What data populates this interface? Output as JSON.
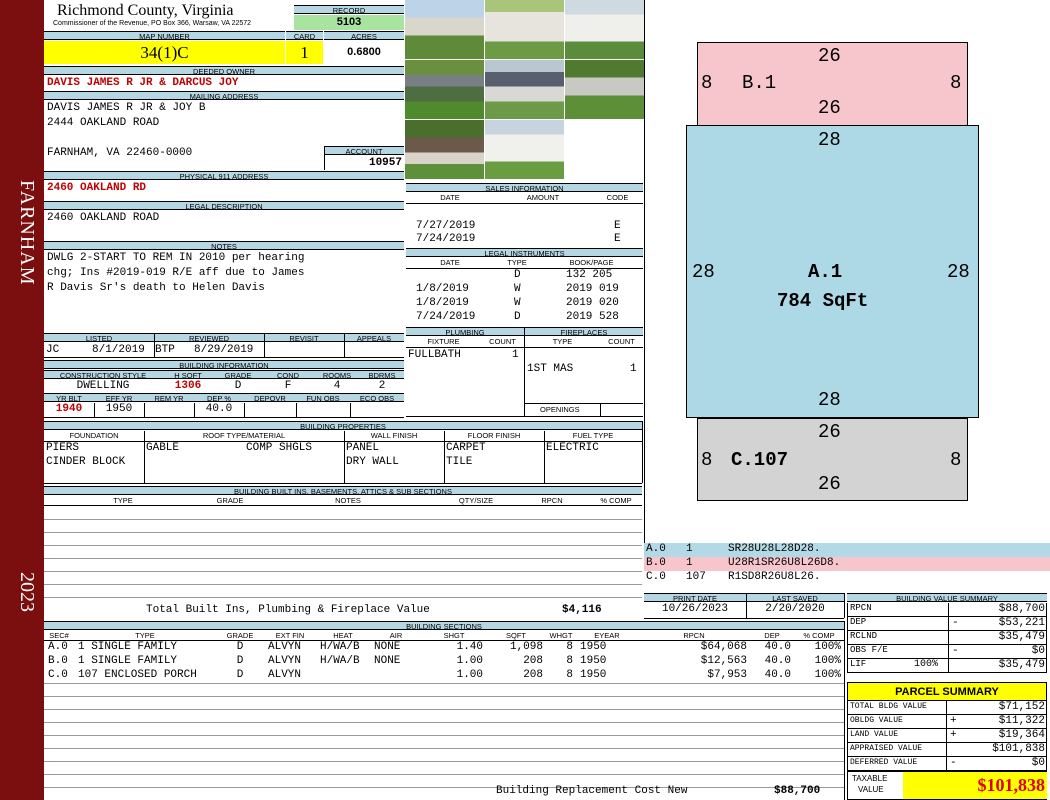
{
  "sidebar": {
    "city": "FARNHAM",
    "year": "2023"
  },
  "header": {
    "county": "Richmond County, Virginia",
    "commissioner": "Commissioner of the Revenue, PO Box 366, Warsaw, VA 22572",
    "record_label": "RECORD",
    "record": "5103",
    "map_label": "MAP NUMBER",
    "map": "34(1)C",
    "card_label": "CARD",
    "card": "1",
    "acres_label": "ACRES",
    "acres": "0.6800"
  },
  "owner": {
    "deeded_label": "DEEDED OWNER",
    "deeded": "DAVIS JAMES R JR & DARCUS JOY",
    "mailing_label": "MAILING ADDRESS",
    "mail1": "DAVIS JAMES R JR & JOY B",
    "mail2": "2444 OAKLAND ROAD",
    "mail3": "FARNHAM, VA 22460-0000",
    "account_label": "ACCOUNT",
    "account": "10957",
    "p911_label": "PHYSICAL 911 ADDRESS",
    "p911": "2460 OAKLAND RD",
    "legal_label": "LEGAL DESCRIPTION",
    "legal": "2460 OAKLAND ROAD"
  },
  "notes": {
    "label": "NOTES",
    "line1": "DWLG 2-START TO REM IN 2010 per hearing",
    "line2": "chg; Ins #2019-019 R/E aff due to James",
    "line3": "R Davis Sr's death to Helen Davis"
  },
  "review": {
    "listed_label": "LISTED",
    "reviewed_label": "REVIEWED",
    "revisit_label": "REVISIT",
    "appeals_label": "APPEALS",
    "lister": "JC",
    "listed": "8/1/2019",
    "reviewer": "BTP",
    "reviewed": "8/29/2019"
  },
  "building_info": {
    "label": "BUILDING INFORMATION",
    "h_const": "CONSTRUCTION STYLE",
    "h_hsqft": "H SQFT",
    "h_grade": "GRADE",
    "h_cond": "COND",
    "h_rooms": "ROOMS",
    "h_bdrms": "BDRMS",
    "const": "DWELLING",
    "hsqft": "1306",
    "grade": "D",
    "cond": "F",
    "rooms": "4",
    "bdrms": "2",
    "h_yrblt": "YR BLT",
    "h_effyr": "EFF YR",
    "h_remyr": "REM YR",
    "h_dep": "DEP %",
    "h_depovr": "DEPOVR",
    "h_funobs": "FUN OBS",
    "h_ecoobs": "ECO OBS",
    "yrblt": "1940",
    "effyr": "1950",
    "dep": "40.0"
  },
  "sales": {
    "label": "SALES INFORMATION",
    "h_date": "DATE",
    "h_amount": "AMOUNT",
    "h_code": "CODE",
    "rows": [
      {
        "date": "7/27/2019",
        "code": "E"
      },
      {
        "date": "7/24/2019",
        "code": "E"
      }
    ]
  },
  "legal_instruments": {
    "label": "LEGAL INSTRUMENTS",
    "h_date": "DATE",
    "h_type": "TYPE",
    "h_book": "BOOK/PAGE",
    "rows": [
      {
        "date": "",
        "type": "D",
        "book": "132 205"
      },
      {
        "date": "1/8/2019",
        "type": "W",
        "book": "2019 019"
      },
      {
        "date": "1/8/2019",
        "type": "W",
        "book": "2019 020"
      },
      {
        "date": "7/24/2019",
        "type": "D",
        "book": "2019 528"
      }
    ]
  },
  "plumbing": {
    "label": "PLUMBING",
    "h_fixture": "FIXTURE",
    "h_count": "COUNT",
    "fixture": "FULLBATH",
    "count": "1"
  },
  "fireplaces": {
    "label": "FIREPLACES",
    "h_type": "TYPE",
    "h_count": "COUNT",
    "type": "1ST MAS",
    "count": "1",
    "openings_label": "OPENINGS"
  },
  "building_properties": {
    "label": "BUILDING PROPERTIES",
    "h_found": "FOUNDATION",
    "h_roof": "ROOF TYPE/MATERIAL",
    "h_wall": "WALL FINISH",
    "h_floor": "FLOOR FINISH",
    "h_fuel": "FUEL TYPE",
    "found1": "PIERS",
    "found2": "CINDER BLOCK",
    "roof_type": "GABLE",
    "roof_mat": "COMP SHGLS",
    "wall1": "PANEL",
    "wall2": "DRY WALL",
    "floor1": "CARPET",
    "floor2": "TILE",
    "fuel": "ELECTRIC"
  },
  "built_ins": {
    "label": "BUILDING BUILT INS, BASEMENTS, ATTICS & SUB SECTIONS",
    "h_type": "TYPE",
    "h_grade": "GRADE",
    "h_notes": "NOTES",
    "h_qty": "QTY/SIZE",
    "h_rpcn": "RPCN",
    "h_comp": "% COMP",
    "total_label": "Total Built Ins, Plumbing & Fireplace Value",
    "total": "$4,116"
  },
  "sketch": {
    "b": {
      "label": "B.1",
      "top": "26",
      "bottom": "26",
      "left": "8",
      "right": "8"
    },
    "a": {
      "label": "A.1",
      "area": "784 SqFt",
      "top": "28",
      "bottom": "28",
      "left": "28",
      "right": "28"
    },
    "c": {
      "label": "C.107",
      "top": "26",
      "bottom": "26",
      "left": "8",
      "right": "8"
    },
    "legend": [
      {
        "sec": "A.0",
        "code": "1",
        "path": "SR28U28L28D28.",
        "color": "#b3d9e6"
      },
      {
        "sec": "B.0",
        "code": "1",
        "path": "U28R1SR26U8L26D8.",
        "color": "#f7c6cc"
      },
      {
        "sec": "C.0",
        "code": "107",
        "path": "R1SD8R26U8L26.",
        "color": "#ffffff"
      }
    ],
    "colors": {
      "a": "#add8e6",
      "b": "#f7c6cc",
      "c": "#d3d3d3"
    }
  },
  "dates": {
    "print_label": "PRINT DATE",
    "print": "10/26/2023",
    "saved_label": "LAST SAVED",
    "saved": "2/20/2020"
  },
  "sections": {
    "label": "BUILDING SECTIONS",
    "h": [
      "SEC#",
      "TYPE",
      "GRADE",
      "EXT FIN",
      "HEAT",
      "AIR",
      "SHGT",
      "SQFT",
      "WHGT",
      "EYEAR",
      "RPCN",
      "DEP",
      "% COMP"
    ],
    "rows": [
      {
        "sec": "A.0",
        "type": "1 SINGLE FAMILY",
        "grade": "D",
        "ext": "ALVYN",
        "heat": "H/WA/B",
        "air": "NONE",
        "shgt": "1.40",
        "sqft": "1,098",
        "whgt": "8",
        "eyear": "1950",
        "rpcn": "$64,068",
        "dep": "40.0",
        "comp": "100%"
      },
      {
        "sec": "B.0",
        "type": "1 SINGLE FAMILY",
        "grade": "D",
        "ext": "ALVYN",
        "heat": "H/WA/B",
        "air": "NONE",
        "shgt": "1.00",
        "sqft": "208",
        "whgt": "8",
        "eyear": "1950",
        "rpcn": "$12,563",
        "dep": "40.0",
        "comp": "100%"
      },
      {
        "sec": "C.0",
        "type": "107 ENCLOSED PORCH",
        "grade": "D",
        "ext": "ALVYN",
        "heat": "",
        "air": "",
        "shgt": "1.00",
        "sqft": "208",
        "whgt": "8",
        "eyear": "1950",
        "rpcn": "$7,953",
        "dep": "40.0",
        "comp": "100%"
      }
    ],
    "brcn_label": "Building Replacement Cost New",
    "brcn": "$88,700"
  },
  "value_summary": {
    "label": "BUILDING VALUE SUMMARY",
    "rows": [
      {
        "k": "RPCN",
        "op": "",
        "v": "$88,700"
      },
      {
        "k": "DEP",
        "op": "-",
        "v": "$53,221"
      },
      {
        "k": "RCLND",
        "op": "",
        "v": "$35,479"
      },
      {
        "k": "OBS F/E",
        "op": "-",
        "v": "$0"
      },
      {
        "k": "LIF",
        "pct": "100%",
        "op": "",
        "v": "$35,479"
      }
    ]
  },
  "parcel": {
    "label": "PARCEL SUMMARY",
    "rows": [
      {
        "k": "TOTAL BLDG VALUE",
        "op": "",
        "v": "$71,152"
      },
      {
        "k": "OBLDG VALUE",
        "op": "+",
        "v": "$11,322"
      },
      {
        "k": "LAND VALUE",
        "op": "+",
        "v": "$19,364"
      },
      {
        "k": "APPRAISED VALUE",
        "op": "",
        "v": "$101,838"
      },
      {
        "k": "DEFERRED VALUE",
        "op": "-",
        "v": "$0"
      }
    ],
    "taxable_label1": "TAXABLE",
    "taxable_label2": "VALUE",
    "taxable": "$101,838"
  }
}
